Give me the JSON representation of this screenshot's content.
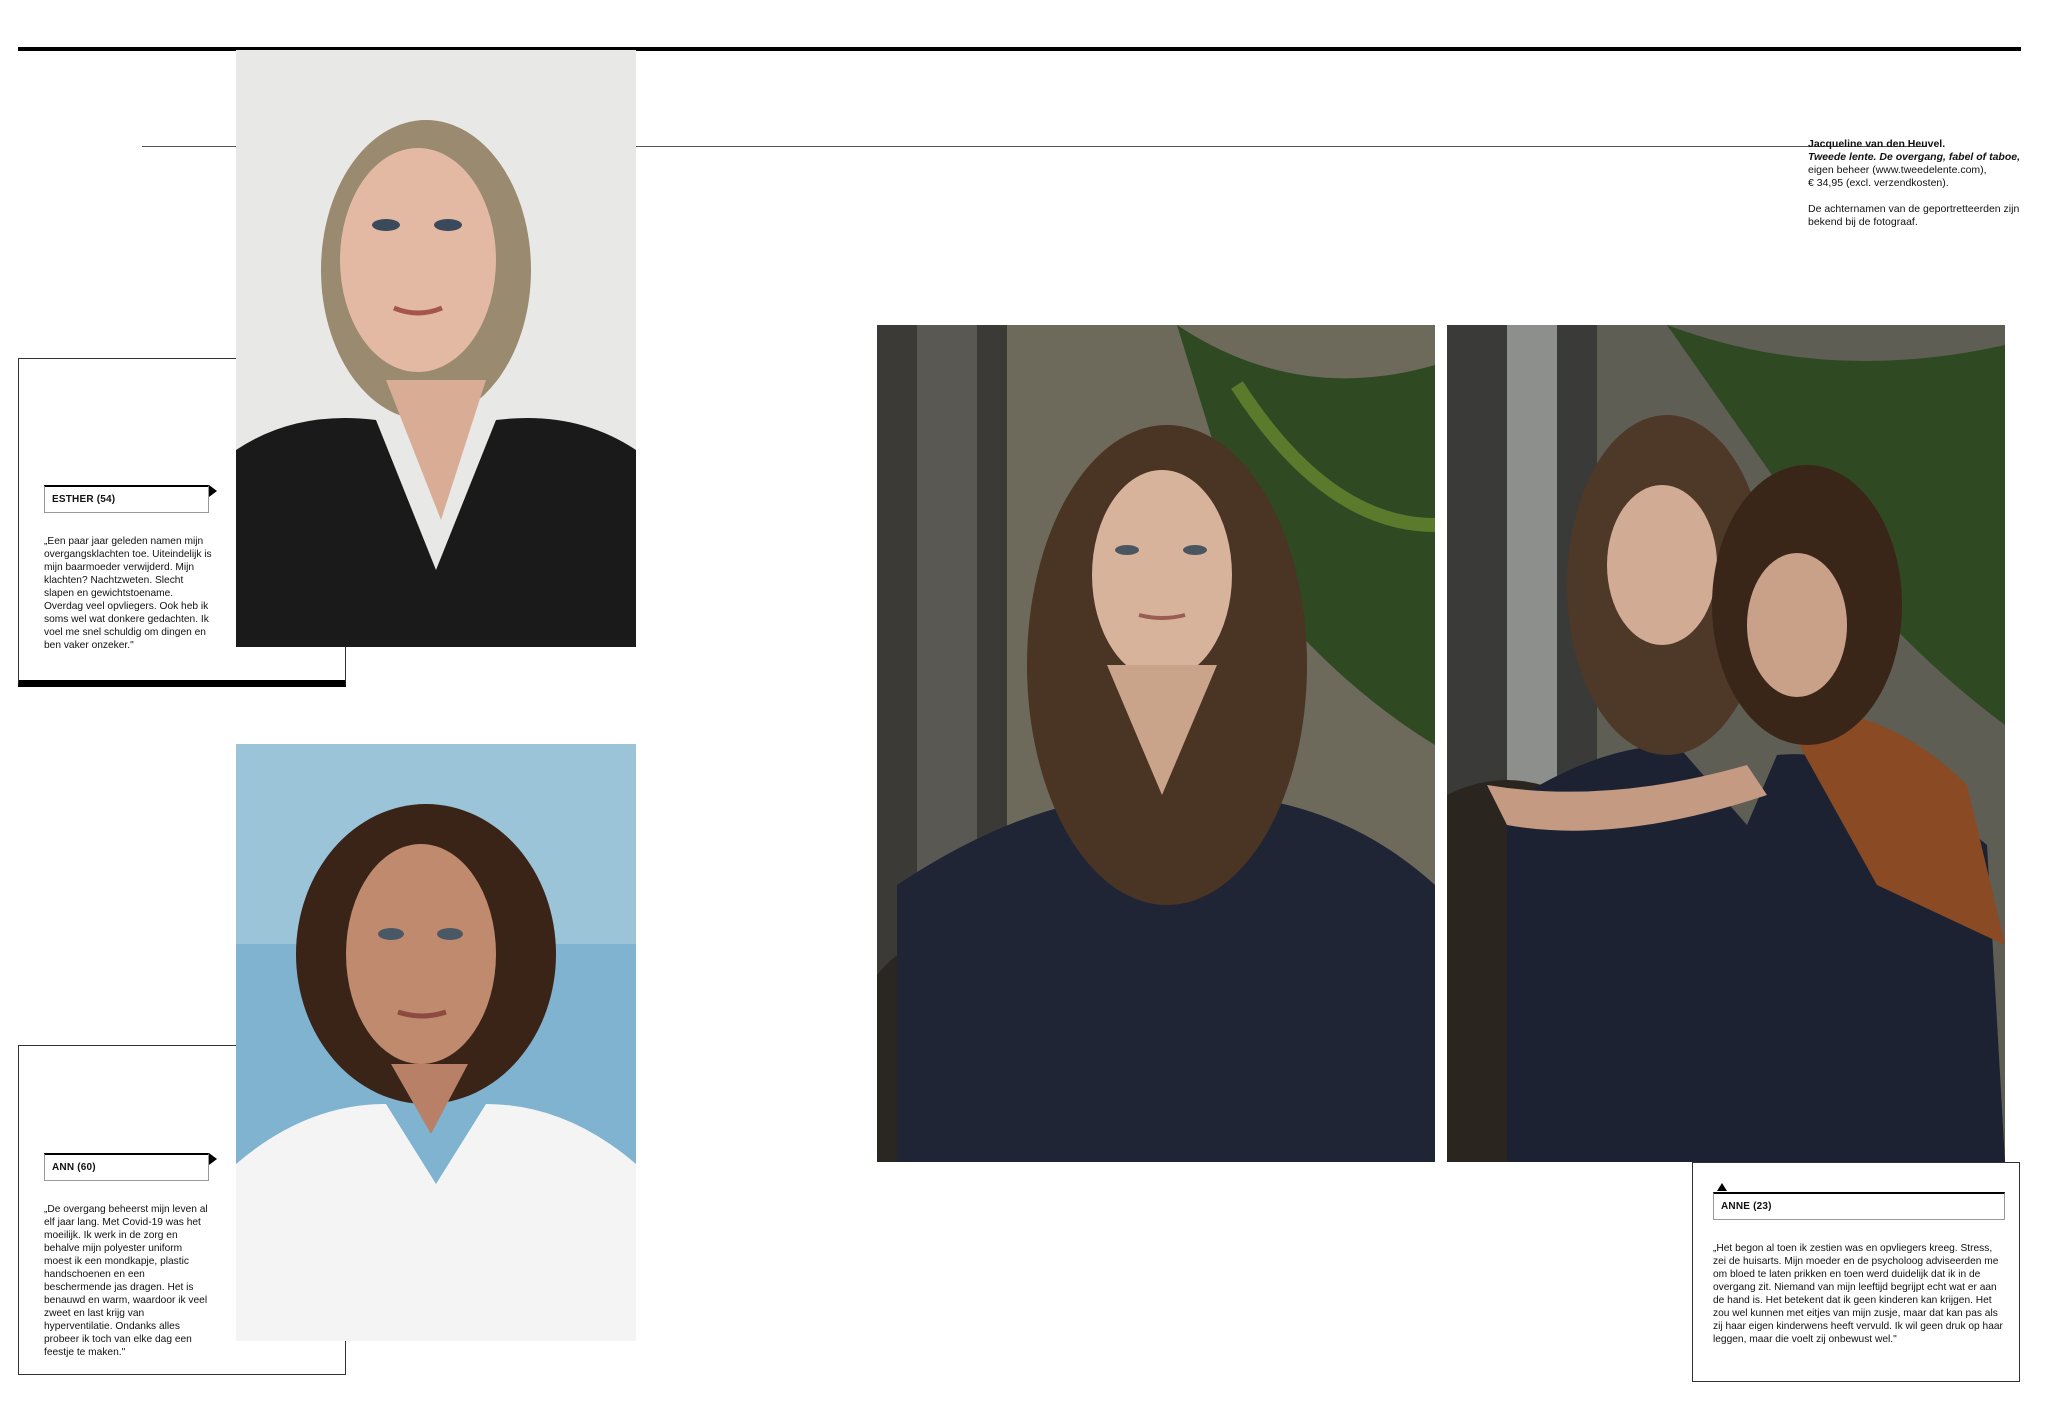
{
  "credits": {
    "author": "Jacqueline van den Heuvel.",
    "book_title": "Tweede lente. De overgang, fabel of taboe,",
    "publisher": "eigen beheer (www.tweedelente.com),",
    "price": "€ 34,95 (excl. verzendkosten).",
    "note": "De achternamen van de geportretteerden zijn bekend bij de fotograaf."
  },
  "profiles": [
    {
      "name": "ESTHER (54)",
      "quote": "„Een paar jaar geleden namen mijn overgangsklachten toe. Uiteindelijk is mijn baarmoeder verwijderd. Mijn klachten? Nachtzweten. Slecht slapen en gewichtstoename. Overdag veel opvliegers. Ook heb ik soms wel wat donkere gedachten. Ik voel me snel schuldig om dingen en ben vaker onzeker.\""
    },
    {
      "name": "ANN (60)",
      "quote": "„De overgang beheerst mijn leven al elf jaar lang. Met Covid-19 was het moeilijk. Ik werk in de zorg en behalve mijn polyester uniform moest ik een mondkapje, plastic handschoenen en een beschermende jas dragen. Het is benauwd en warm, waardoor ik veel zweet en last krijg van hyperventilatie. Ondanks alles probeer ik toch van elke dag een feestje te maken.\""
    },
    {
      "name": "ANNE (23)",
      "quote": "„Het begon al toen ik zestien was en opvliegers kreeg. Stress, zei de huisarts. Mijn moeder en de psycholoog adviseerden me om bloed te laten prikken en toen werd duidelijk dat ik in de overgang zit. Niemand van mijn leeftijd begrijpt echt wat er aan de hand is. Het betekent dat ik geen kinderen kan krijgen. Het zou wel kunnen met eitjes van mijn zusje, maar dat kan pas als zij haar eigen kinderwens heeft vervuld. Ik wil geen druk op haar leggen, maar die voelt zij onbewust wel.\""
    }
  ]
}
